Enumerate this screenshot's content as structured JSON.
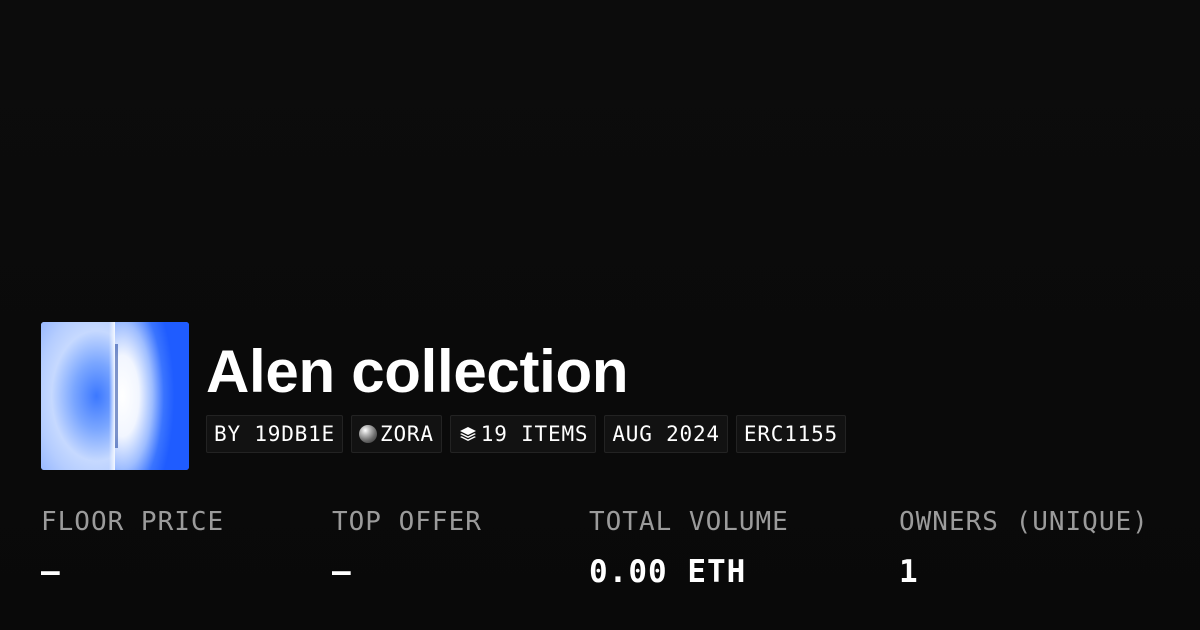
{
  "collection": {
    "name": "Alen collection",
    "thumbnail_icon": "collection-artwork-image",
    "tags": [
      {
        "label": "BY 19DB1E"
      },
      {
        "label": "ZORA",
        "icon": "zora-orb-icon"
      },
      {
        "label": "19 ITEMS",
        "icon": "layers-icon"
      },
      {
        "label": "AUG 2024"
      },
      {
        "label": "ERC1155"
      }
    ]
  },
  "stats": [
    {
      "label": "FLOOR PRICE",
      "value": "–"
    },
    {
      "label": "TOP OFFER",
      "value": "–"
    },
    {
      "label": "TOTAL VOLUME",
      "value": "0.00 ETH"
    },
    {
      "label": "OWNERS (UNIQUE)",
      "value": "1"
    }
  ],
  "colors": {
    "background": "#0a0a0a",
    "text": "#ffffff",
    "muted": "#9b9b9b",
    "tag_background": "#121212",
    "tag_border": "#232323",
    "artwork_blue": "#1f5cff"
  }
}
